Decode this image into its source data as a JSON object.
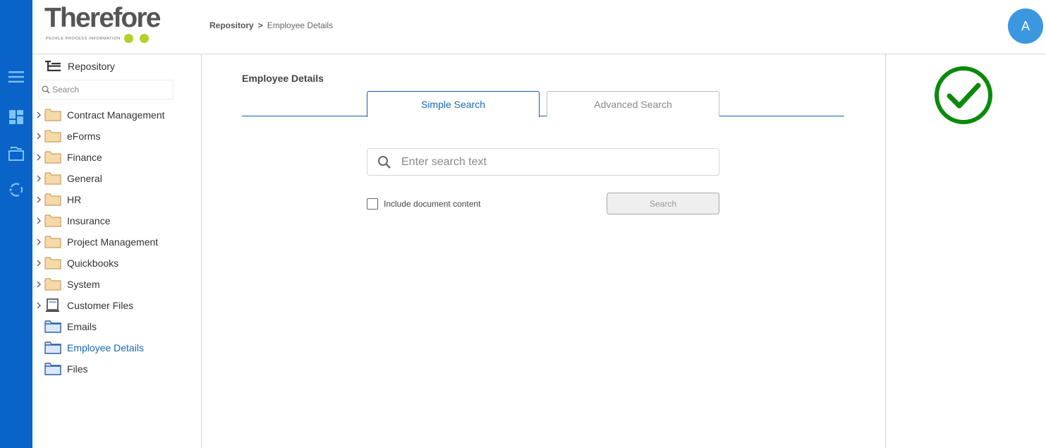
{
  "app": {
    "logo_text": "Therefore",
    "logo_tagline": "PEOPLE  PROCESS  INFORMATION",
    "brand_color": "#0a63c9",
    "accent_green": "#b7cf29"
  },
  "rail": {
    "icons": [
      "menu-icon",
      "dashboard-icon",
      "repository-icon",
      "workflow-icon"
    ]
  },
  "header": {
    "breadcrumb": {
      "root": "Repository",
      "separator": ">",
      "current": "Employee Details"
    },
    "avatar_initial": "A"
  },
  "tree": {
    "root_label": "Repository",
    "search_placeholder": "Search",
    "items": [
      {
        "label": "Contract Management",
        "icon": "folder-icon",
        "expandable": true
      },
      {
        "label": "eForms",
        "icon": "folder-icon",
        "expandable": true
      },
      {
        "label": "Finance",
        "icon": "folder-icon",
        "expandable": true
      },
      {
        "label": "General",
        "icon": "folder-icon",
        "expandable": true
      },
      {
        "label": "HR",
        "icon": "folder-icon",
        "expandable": true
      },
      {
        "label": "Insurance",
        "icon": "folder-icon",
        "expandable": true
      },
      {
        "label": "Project Management",
        "icon": "folder-icon",
        "expandable": true
      },
      {
        "label": "Quickbooks",
        "icon": "folder-icon",
        "expandable": true
      },
      {
        "label": "System",
        "icon": "folder-icon",
        "expandable": true
      },
      {
        "label": "Customer Files",
        "icon": "case-icon",
        "expandable": true
      },
      {
        "label": "Emails",
        "icon": "category-icon",
        "expandable": false
      },
      {
        "label": "Employee Details",
        "icon": "category-icon",
        "expandable": false,
        "active": true
      },
      {
        "label": "Files",
        "icon": "category-icon",
        "expandable": false
      }
    ]
  },
  "main": {
    "title": "Employee Details",
    "tabs": [
      {
        "label": "Simple Search",
        "active": true
      },
      {
        "label": "Advanced Search",
        "active": false
      }
    ],
    "search_placeholder": "Enter search text",
    "include_content_label": "Include document content",
    "search_button": "Search"
  },
  "status": {
    "icon": "check-circle-icon",
    "color": "#0a8a0a"
  }
}
